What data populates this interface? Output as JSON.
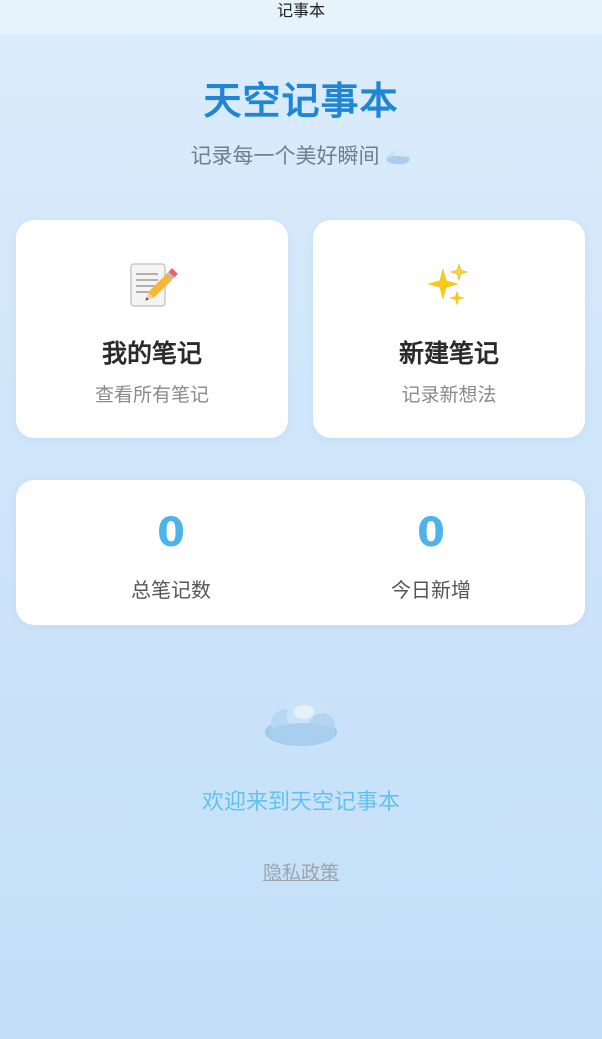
{
  "nav": {
    "title": "记事本"
  },
  "header": {
    "app_title": "天空记事本",
    "subtitle": "记录每一个美好瞬间"
  },
  "cards": [
    {
      "icon": "memo-pencil-icon",
      "title": "我的笔记",
      "desc": "查看所有笔记"
    },
    {
      "icon": "sparkles-icon",
      "title": "新建笔记",
      "desc": "记录新想法"
    }
  ],
  "stats": {
    "total_value": "0",
    "total_label": "总笔记数",
    "today_value": "0",
    "today_label": "今日新增"
  },
  "welcome": "欢迎来到天空记事本",
  "footer": {
    "privacy_label": "隐私政策"
  },
  "colors": {
    "title": "#1f86d6",
    "stat_value": "#4db3ea",
    "welcome": "#62c2ef",
    "background": "#cfe5fa"
  }
}
